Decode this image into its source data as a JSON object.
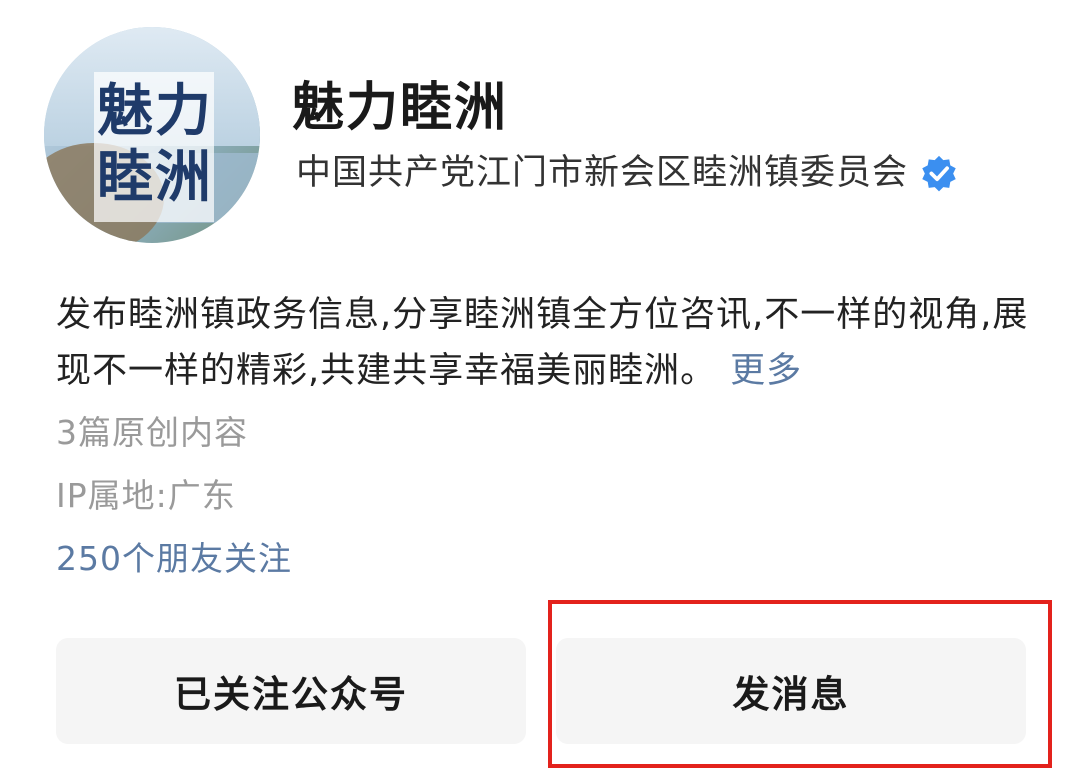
{
  "profile": {
    "avatar_text_line1": "魅力",
    "avatar_text_line2": "睦洲",
    "name": "魅力睦洲",
    "organization": "中国共产党江门市新会区睦洲镇委员会",
    "verified_icon": "verified-badge-icon",
    "description": "发布睦洲镇政务信息,分享睦洲镇全方位咨讯,不一样的视角,展现不一样的精彩,共建共享幸福美丽睦洲。",
    "more_label": "更多",
    "articles_count": "3篇原创内容",
    "ip_location": "IP属地:广东",
    "friends_following": "250个朋友关注"
  },
  "actions": {
    "follow_label": "已关注公众号",
    "message_label": "发消息"
  },
  "colors": {
    "link": "#5b7aa3",
    "verified": "#3b8ff0",
    "highlight": "#e3221c",
    "button_bg": "#f5f5f5"
  }
}
